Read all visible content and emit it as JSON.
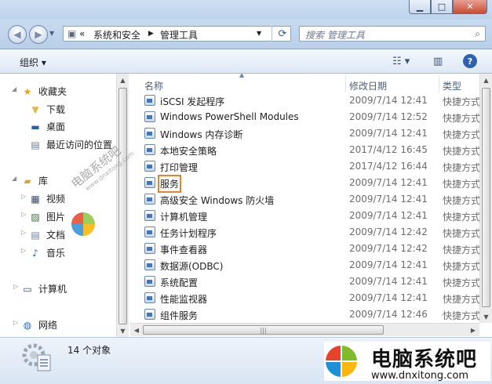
{
  "address": {
    "crumb_parent": "系统和安全",
    "crumb_current": "管理工具"
  },
  "search": {
    "placeholder": "搜索 管理工具"
  },
  "toolbar": {
    "organize_label": "组织 ▾"
  },
  "nav": {
    "favorites": "收藏夹",
    "downloads": "下载",
    "desktop": "桌面",
    "recent": "最近访问的位置",
    "libraries": "库",
    "videos": "视频",
    "pictures": "图片",
    "documents": "文档",
    "music": "音乐",
    "computer": "计算机",
    "network": "网络"
  },
  "columns": {
    "name": "名称",
    "date": "修改日期",
    "type": "类型"
  },
  "files": [
    {
      "name": "iSCSI 发起程序",
      "date": "2009/7/14 12:41",
      "type": "快捷方式"
    },
    {
      "name": "Windows PowerShell Modules",
      "date": "2009/7/14 12:52",
      "type": "快捷方式"
    },
    {
      "name": "Windows 内存诊断",
      "date": "2009/7/14 12:41",
      "type": "快捷方式"
    },
    {
      "name": "本地安全策略",
      "date": "2017/4/12 16:45",
      "type": "快捷方式"
    },
    {
      "name": "打印管理",
      "date": "2017/4/12 16:44",
      "type": "快捷方式"
    },
    {
      "name": "服务",
      "date": "2009/7/14 12:41",
      "type": "快捷方式"
    },
    {
      "name": "高级安全 Windows 防火墙",
      "date": "2009/7/14 12:41",
      "type": "快捷方式"
    },
    {
      "name": "计算机管理",
      "date": "2009/7/14 12:41",
      "type": "快捷方式"
    },
    {
      "name": "任务计划程序",
      "date": "2009/7/14 12:42",
      "type": "快捷方式"
    },
    {
      "name": "事件查看器",
      "date": "2009/7/14 12:42",
      "type": "快捷方式"
    },
    {
      "name": "数据源(ODBC)",
      "date": "2009/7/14 12:41",
      "type": "快捷方式"
    },
    {
      "name": "系统配置",
      "date": "2009/7/14 12:41",
      "type": "快捷方式"
    },
    {
      "name": "性能监视器",
      "date": "2009/7/14 12:41",
      "type": "快捷方式"
    },
    {
      "name": "组件服务",
      "date": "2009/7/14 12:46",
      "type": "快捷方式"
    }
  ],
  "status": {
    "count": "14 个对象"
  },
  "watermark": {
    "brand": "电脑系统吧",
    "url": "www.dnxitong.com",
    "diag_text": "电脑系统吧",
    "diag_url": "www.dnxitong.com"
  }
}
